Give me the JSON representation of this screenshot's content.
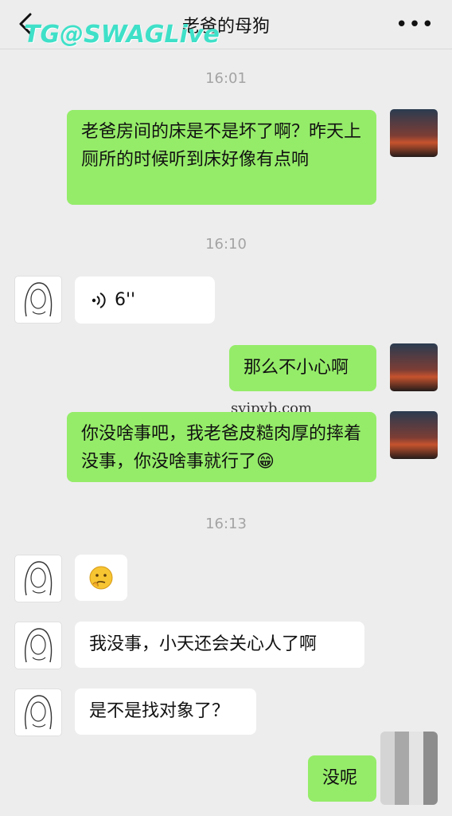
{
  "header": {
    "title": "老爸的母狗",
    "back_icon": "chevron-left-icon",
    "more_label": "•••"
  },
  "watermark": {
    "text": "TG@SWAGLive"
  },
  "site_watermark": {
    "text": "svipvb.com"
  },
  "timestamps": [
    "16:01",
    "16:10",
    "16:13"
  ],
  "messages": [
    {
      "side": "right",
      "type": "text",
      "text": "老爸房间的床是不是坏了啊？昨天上厕所的时候听到床好像有点响"
    },
    {
      "side": "left",
      "type": "voice",
      "duration": "6''"
    },
    {
      "side": "right",
      "type": "text",
      "text": "那么不小心啊"
    },
    {
      "side": "right",
      "type": "text",
      "text": "你没啥事吧，我老爸皮糙肉厚的摔着没事，你没啥事就行了😁"
    },
    {
      "side": "left",
      "type": "emoji",
      "emoji": "thinking-face"
    },
    {
      "side": "left",
      "type": "text",
      "text": "我没事，小天还会关心人了啊"
    },
    {
      "side": "left",
      "type": "text",
      "text": "是不是找对象了？"
    },
    {
      "side": "right",
      "type": "text",
      "text": "没呢"
    }
  ],
  "colors": {
    "bubble_green": "#95ec69",
    "bubble_white": "#ffffff",
    "background": "#ededed"
  }
}
